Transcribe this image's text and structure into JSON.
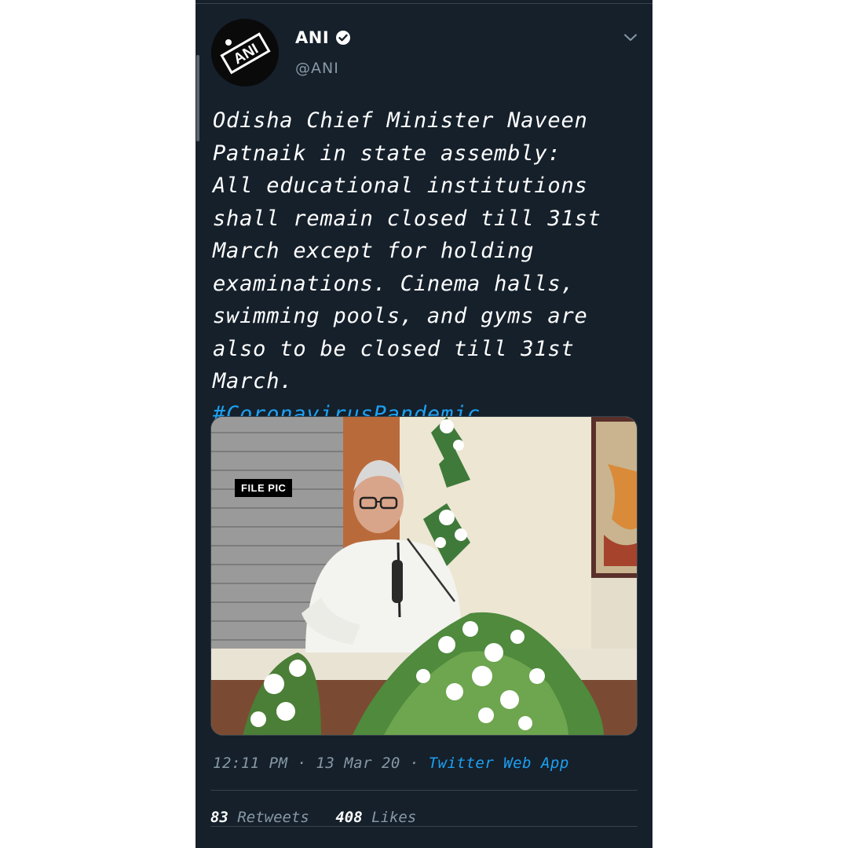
{
  "account": {
    "display_name": "ANI",
    "handle": "@ANI",
    "avatar_text": "ANI",
    "verified": true
  },
  "tweet": {
    "text": "Odisha Chief Minister Naveen\nPatnaik in state assembly:\nAll educational institutions\nshall remain closed till 31st\nMarch except for holding\nexaminations. Cinema halls,\nswimming pools, and gyms are\nalso to be closed till 31st March.",
    "hashtag": "#CoronavirusPandemic"
  },
  "media": {
    "overlay_label": "FILE PIC"
  },
  "meta": {
    "time": "12:11 PM",
    "date": "13 Mar 20",
    "separator": "·",
    "source": "Twitter Web App"
  },
  "stats": {
    "retweets_count": "83",
    "retweets_label": "Retweets",
    "likes_count": "408",
    "likes_label": "Likes"
  },
  "colors": {
    "background": "#15202b",
    "accent": "#1da1f2",
    "secondary_text": "#8899a6"
  },
  "icons": [
    "verified-badge-icon",
    "chevron-down-icon"
  ]
}
